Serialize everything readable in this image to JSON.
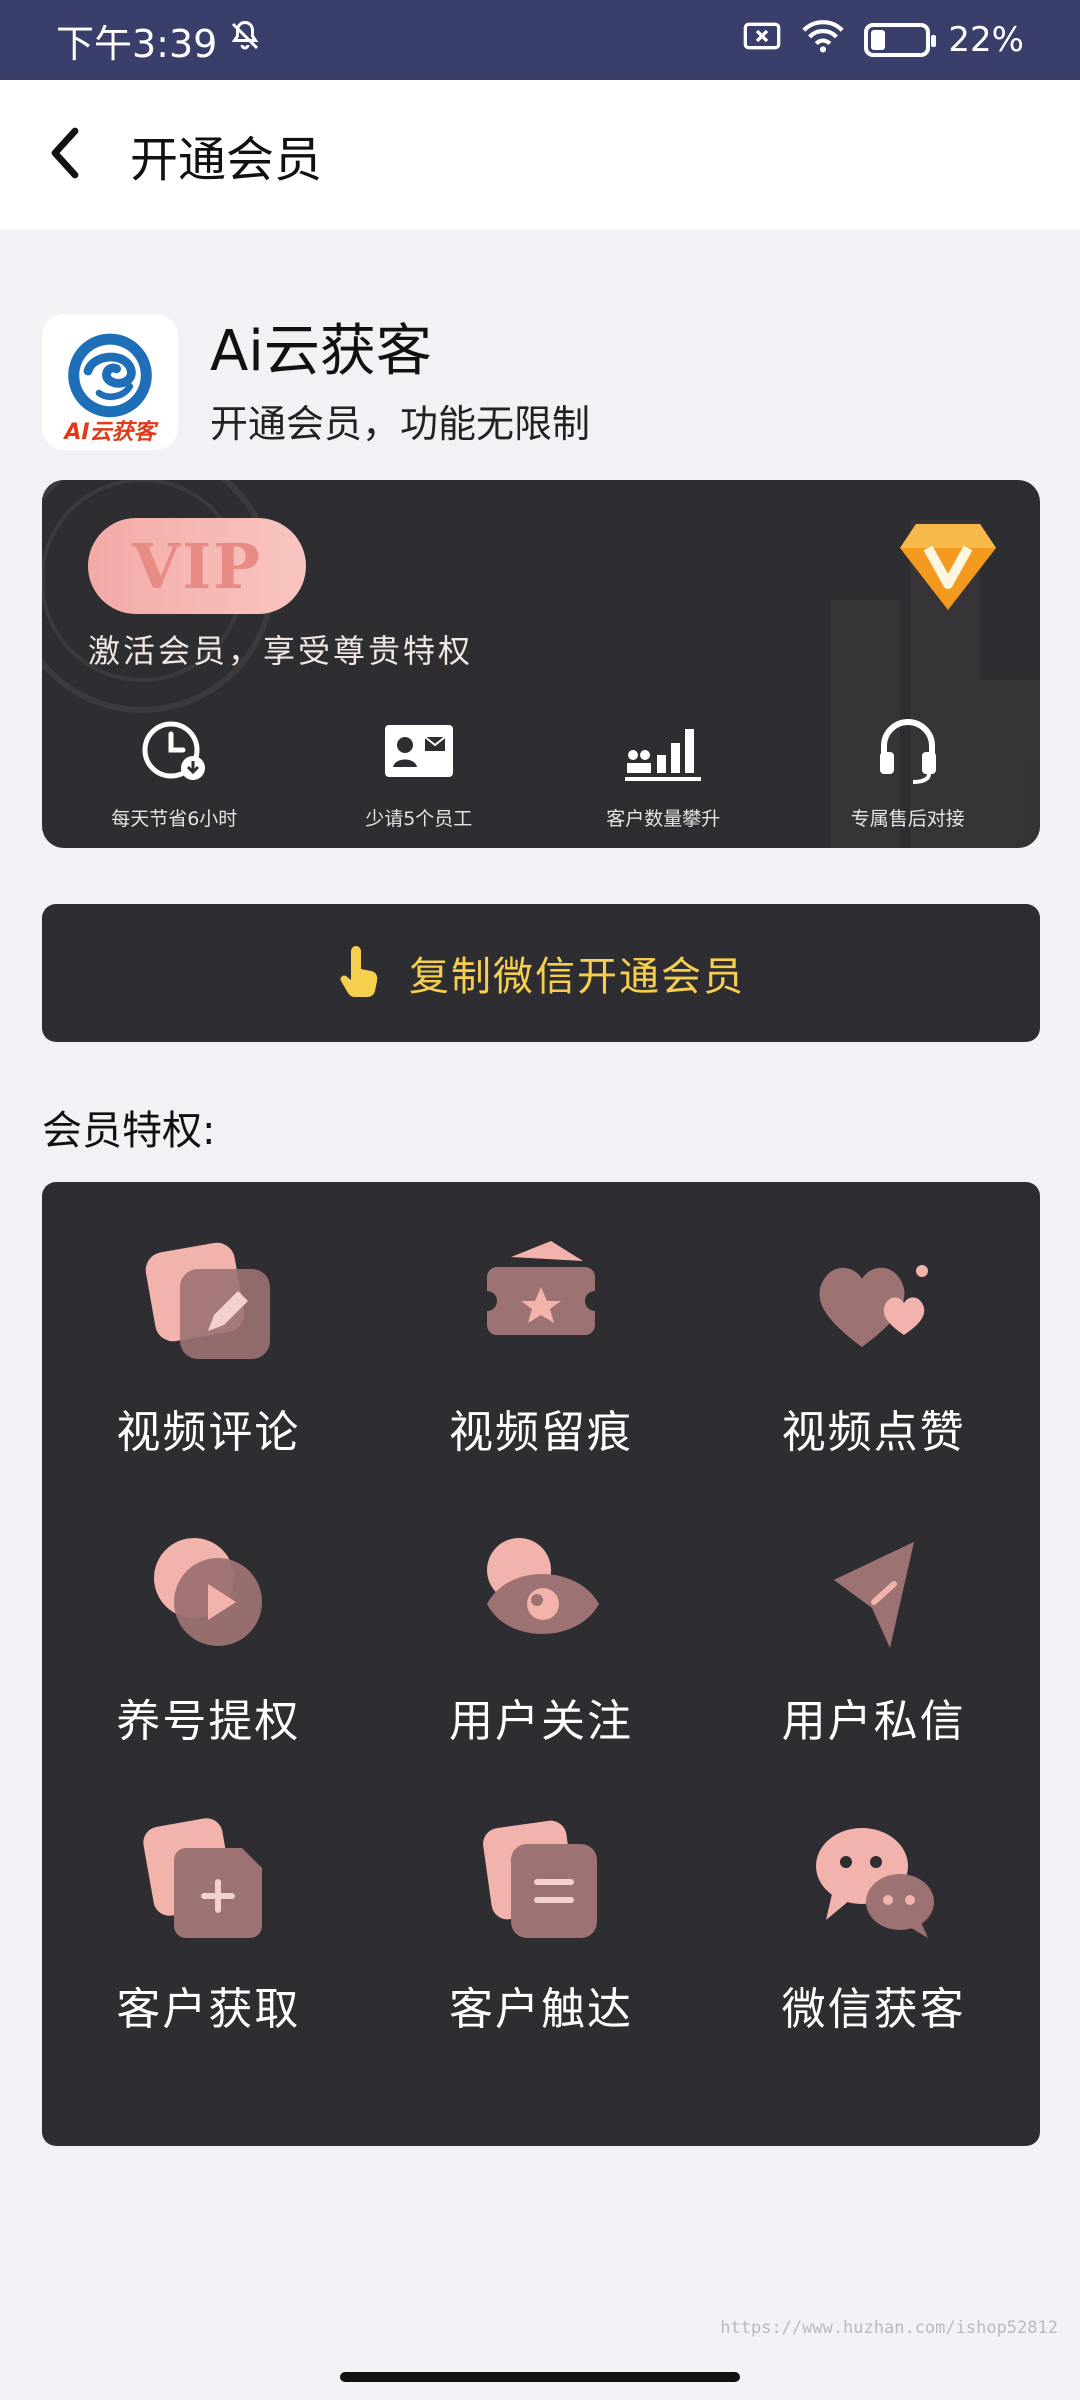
{
  "status_bar": {
    "time": "下午3:39",
    "battery": "22%",
    "battery_level": 0.22,
    "icons": [
      "bell-off-icon",
      "sim-x-icon",
      "wifi-icon",
      "battery-icon"
    ]
  },
  "header": {
    "title": "开通会员",
    "back_icon": "chevron-left-icon"
  },
  "app": {
    "name": "Ai云获客",
    "slogan": "开通会员，功能无限制",
    "logo_text": "AI云获客"
  },
  "vip_card": {
    "badge": "VIP",
    "tagline": "激活会员，享受尊贵特权",
    "perks": [
      {
        "label": "每天节省6小时",
        "icon": "clock-icon"
      },
      {
        "label": "少请5个员工",
        "icon": "id-card-icon"
      },
      {
        "label": "客户数量攀升",
        "icon": "bar-growth-icon"
      },
      {
        "label": "专属售后对接",
        "icon": "headset-icon"
      }
    ],
    "colors": {
      "card": "#2e2d31",
      "badge": "#f3aaa6",
      "diamond": "#f39a1e"
    }
  },
  "activate_button": {
    "label": "复制微信开通会员",
    "icon": "hand-tap-icon",
    "color": "#f6cf4f"
  },
  "privileges": {
    "title": "会员特权:",
    "items": [
      {
        "label": "视频评论",
        "icon": "edit-comment-icon"
      },
      {
        "label": "视频留痕",
        "icon": "ticket-star-icon"
      },
      {
        "label": "视频点赞",
        "icon": "hearts-icon"
      },
      {
        "label": "养号提权",
        "icon": "play-circle-icon"
      },
      {
        "label": "用户关注",
        "icon": "eye-follow-icon"
      },
      {
        "label": "用户私信",
        "icon": "send-icon"
      },
      {
        "label": "客户获取",
        "icon": "add-file-icon"
      },
      {
        "label": "客户触达",
        "icon": "list-file-icon"
      },
      {
        "label": "微信获客",
        "icon": "wechat-icon"
      }
    ]
  },
  "watermark": "https://www.huzhan.com/ishop52812"
}
